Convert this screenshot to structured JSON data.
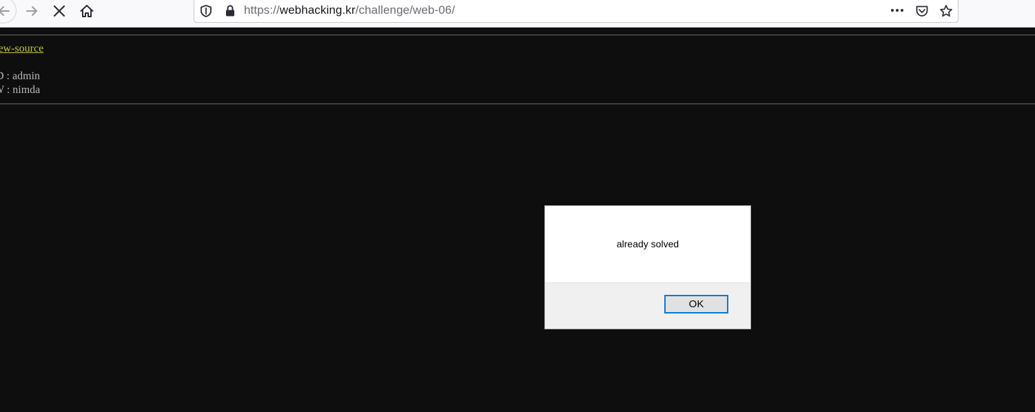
{
  "browser": {
    "url_scheme": "https://",
    "url_domain": "webhacking.kr",
    "url_path": "/challenge/web-06/",
    "icons": {
      "back": "arrow-left-icon",
      "forward": "arrow-right-icon",
      "stop": "close-x-icon",
      "home": "home-icon",
      "tracking": "shield-icon",
      "lock": "lock-icon",
      "more": "ellipsis-icon",
      "pocket": "pocket-icon",
      "bookmark": "star-icon"
    }
  },
  "page": {
    "view_source_link": "iew-source",
    "id_line": "D : admin",
    "pw_line": "W : nimda",
    "colors": {
      "background": "#0e0e0e",
      "link": "#c8c832",
      "text": "#b8b8b8"
    }
  },
  "dialog": {
    "message": "already solved",
    "ok_label": "OK",
    "accent": "#0078d7"
  }
}
